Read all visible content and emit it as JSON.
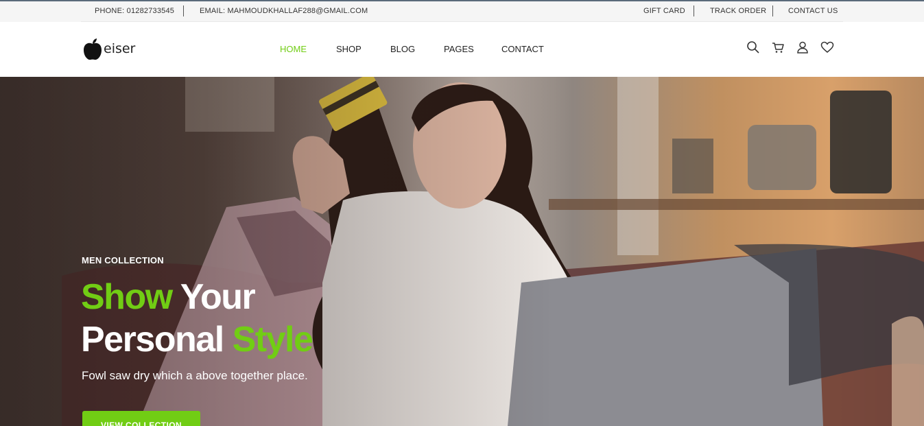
{
  "topbar": {
    "phone": "PHONE: 01282733545",
    "email": "EMAIL: MAHMOUDKHALLAF288@GMAIL.COM",
    "links": [
      "GIFT CARD",
      "TRACK ORDER",
      "CONTACT US"
    ]
  },
  "header": {
    "logo_text": "eiser",
    "logo_icon": "apple-icon",
    "nav": [
      "HOME",
      "SHOP",
      "BLOG",
      "PAGES",
      "CONTACT"
    ],
    "active_nav": "HOME",
    "icons": [
      "search-icon",
      "cart-icon",
      "user-icon",
      "heart-icon"
    ]
  },
  "hero": {
    "subtitle": "MEN COLLECTION",
    "headline_word1": "Show",
    "headline_word2": "Your",
    "headline_word3": "Personal",
    "headline_word4": "Style",
    "tagline": "Fowl saw dry which a above together place.",
    "cta_label": "VIEW COLLECTION"
  },
  "colors": {
    "accent": "#71cd14",
    "text_dark": "#222222",
    "topbar_bg": "#f5f5f5"
  }
}
